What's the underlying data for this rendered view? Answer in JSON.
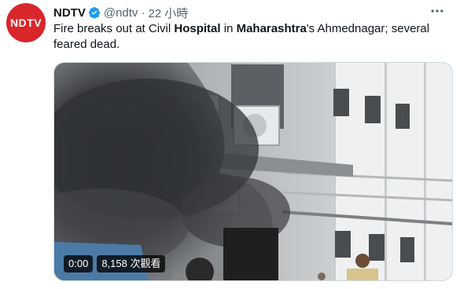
{
  "account": {
    "avatar_text": "NDTV",
    "name": "NDTV",
    "handle": "@ndtv",
    "separator": "·",
    "time": "22 小時"
  },
  "tweet": {
    "parts": [
      {
        "text": "Fire breaks out at Civil ",
        "bold": false
      },
      {
        "text": "Hospital",
        "bold": true
      },
      {
        "text": " in ",
        "bold": false
      },
      {
        "text": "Maharashtra",
        "bold": true
      },
      {
        "text": "'s Ahmednagar; several feared dead.",
        "bold": false
      }
    ]
  },
  "video": {
    "duration": "0:00",
    "views": "8,158 次觀看"
  },
  "colors": {
    "brand": "#d9262b",
    "verified": "#1d9bf0",
    "secondary_text": "#536471",
    "smoke": "#3b3d40"
  },
  "icons": {
    "verified": "verified-badge-icon",
    "more": "more-options-icon"
  }
}
